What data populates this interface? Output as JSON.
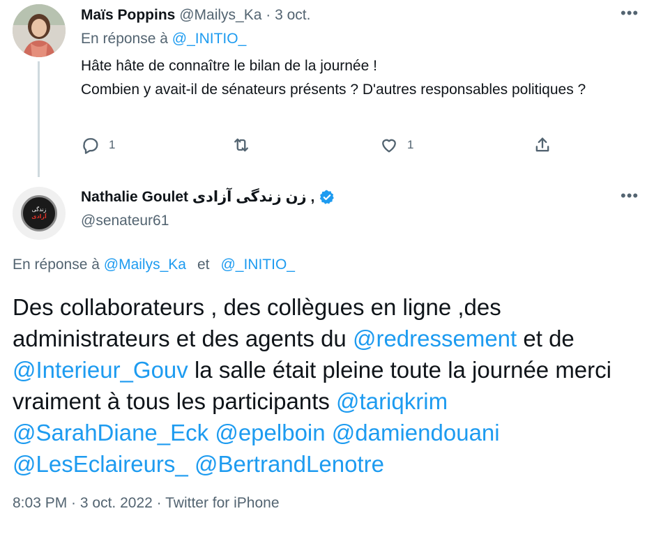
{
  "reply_tweet": {
    "display_name": "Maïs Poppins",
    "handle": "@Mailys_Ka",
    "separator": " · ",
    "date": "3 oct.",
    "reply_prefix": "En réponse à ",
    "reply_to": "@_INITIO_",
    "text_line1": "Hâte hâte de connaître le bilan de la journée !",
    "text_line2": "Combien y avait-il de sénateurs présents ? D'autres responsables politiques ?",
    "actions": {
      "reply_count": "1",
      "retweet_count": "",
      "like_count": "1"
    },
    "more_icon": "more-dots-icon"
  },
  "main_tweet": {
    "display_name": "Nathalie Goulet زن زندگی آزادی ,",
    "handle": "@senateur61",
    "verified": true,
    "avatar_badge_top": "زندگی",
    "avatar_badge_bottom": "آزادی",
    "reply_prefix": "En réponse à ",
    "reply_to_1": "@Mailys_Ka",
    "reply_and": "et",
    "reply_to_2": "@_INITIO_",
    "text": {
      "p1": "Des collaborateurs , des collègues en ligne ,des administrateurs et des agents du ",
      "m1": "@redressement",
      "p2": " et de ",
      "m2": "@Interieur_Gouv",
      "p3": " la salle était pleine toute la journée merci vraiment à tous les participants ",
      "m3": "@tariqkrim",
      "m4": "@SarahDiane_Eck",
      "m5": "@epelboin",
      "m6": "@damiendouani",
      "m7": "@LesEclaireurs_",
      "m8": "@BertrandLenotre"
    },
    "time": "8:03 PM",
    "separator": " · ",
    "date": "3 oct. 2022",
    "source": "Twitter for iPhone"
  },
  "colors": {
    "link": "#1d9bf0",
    "secondary_text": "#536471",
    "primary_text": "#0f1419",
    "verified": "#1d9bf0"
  }
}
